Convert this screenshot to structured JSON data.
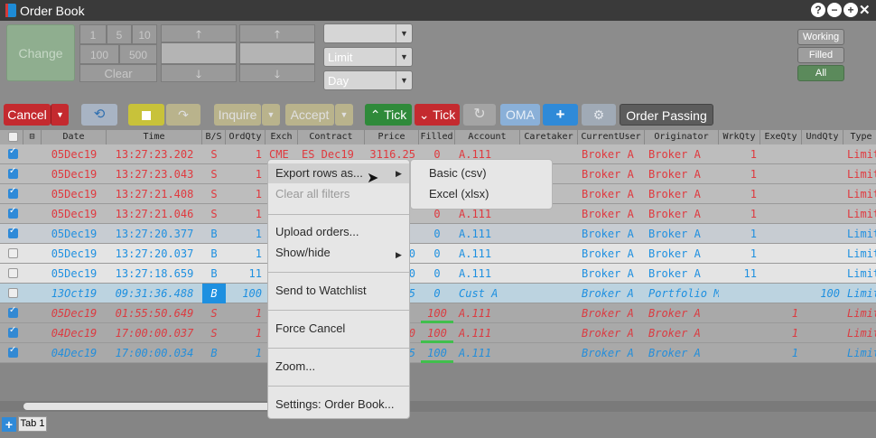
{
  "window": {
    "title": "Order Book",
    "controls": [
      "?",
      "−",
      "+",
      "✕"
    ]
  },
  "order_panel": {
    "change_label": "Change",
    "qty_keys": [
      "1",
      "5",
      "10",
      "100",
      "500"
    ],
    "clear_label": "Clear",
    "up_arrow": "🡑",
    "down_arrow": "🡓"
  },
  "selects": {
    "first_value": "",
    "order_type": "Limit",
    "duration": "Day"
  },
  "status_filters": {
    "working": "Working",
    "filled": "Filled",
    "all": "All"
  },
  "toolbar": {
    "cancel": "Cancel",
    "inquire": "Inquire",
    "accept": "Accept",
    "tick_up": "Tick",
    "tick_down": "Tick",
    "oma": "OMA",
    "add": "+",
    "order_passing": "Order Passing"
  },
  "columns": [
    "",
    "",
    "Date",
    "Time",
    "B/S",
    "OrdQty",
    "Exch",
    "Contract",
    "Price",
    "Filled",
    "Account",
    "Caretaker",
    "CurrentUser",
    "Originator",
    "WrkQty",
    "ExeQty",
    "UndQty",
    "Type"
  ],
  "rows": [
    {
      "checked": true,
      "date": "05Dec19",
      "time": "13:27:23.202",
      "bs": "S",
      "ordqty": "1",
      "exch": "CME",
      "contract": "ES Dec19",
      "price": "3116.25",
      "filled": "0",
      "account": "A.111",
      "caretaker": "",
      "currentuser": "Broker A",
      "originator": "Broker A",
      "wrkqty": "1",
      "exeqty": "",
      "undqty": "",
      "type": "Limit"
    },
    {
      "checked": true,
      "date": "05Dec19",
      "time": "13:27:23.043",
      "bs": "S",
      "ordqty": "1",
      "exch": "",
      "contract": "",
      "price": "",
      "filled": "",
      "account": "",
      "caretaker": "",
      "currentuser": "Broker A",
      "originator": "Broker A",
      "wrkqty": "1",
      "exeqty": "",
      "undqty": "",
      "type": "Limit"
    },
    {
      "checked": true,
      "date": "05Dec19",
      "time": "13:27:21.408",
      "bs": "S",
      "ordqty": "1",
      "exch": "",
      "contract": "",
      "price": "",
      "filled": "",
      "account": "",
      "caretaker": "",
      "currentuser": "Broker A",
      "originator": "Broker A",
      "wrkqty": "1",
      "exeqty": "",
      "undqty": "",
      "type": "Limit"
    },
    {
      "checked": true,
      "date": "05Dec19",
      "time": "13:27:21.046",
      "bs": "S",
      "ordqty": "1",
      "exch": "",
      "contract": "",
      "price": "",
      "filled": "0",
      "account": "A.111",
      "caretaker": "",
      "currentuser": "Broker A",
      "originator": "Broker A",
      "wrkqty": "1",
      "exeqty": "",
      "undqty": "",
      "type": "Limit"
    },
    {
      "checked": true,
      "date": "05Dec19",
      "time": "13:27:20.377",
      "bs": "B",
      "ordqty": "1",
      "exch": "",
      "contract": "",
      "price": "",
      "filled": "0",
      "account": "A.111",
      "caretaker": "",
      "currentuser": "Broker A",
      "originator": "Broker A",
      "wrkqty": "1",
      "exeqty": "",
      "undqty": "",
      "type": "Limit"
    },
    {
      "checked": false,
      "date": "05Dec19",
      "time": "13:27:20.037",
      "bs": "B",
      "ordqty": "1",
      "exch": "",
      "contract": "",
      "price": "0",
      "filled": "0",
      "account": "A.111",
      "caretaker": "",
      "currentuser": "Broker A",
      "originator": "Broker A",
      "wrkqty": "1",
      "exeqty": "",
      "undqty": "",
      "type": "Limit"
    },
    {
      "checked": false,
      "date": "05Dec19",
      "time": "13:27:18.659",
      "bs": "B",
      "ordqty": "11",
      "exch": "",
      "contract": "",
      "price": "0",
      "filled": "0",
      "account": "A.111",
      "caretaker": "",
      "currentuser": "Broker A",
      "originator": "Broker A",
      "wrkqty": "11",
      "exeqty": "",
      "undqty": "",
      "type": "Limit"
    },
    {
      "checked": false,
      "date": "13Oct19",
      "time": "09:31:36.488",
      "bs": "B",
      "ordqty": "100",
      "exch": "",
      "contract": "",
      "price": "5",
      "filled": "0",
      "account": "Cust A",
      "caretaker": "",
      "currentuser": "Broker A",
      "originator": "Portfolio M",
      "wrkqty": "",
      "exeqty": "",
      "undqty": "100",
      "type": "Limit"
    },
    {
      "checked": true,
      "date": "05Dec19",
      "time": "01:55:50.649",
      "bs": "S",
      "ordqty": "1",
      "exch": "",
      "contract": "",
      "price": "",
      "filled": "100",
      "account": "A.111",
      "caretaker": "",
      "currentuser": "Broker A",
      "originator": "Broker A",
      "wrkqty": "",
      "exeqty": "1",
      "undqty": "",
      "type": "Limit"
    },
    {
      "checked": true,
      "date": "04Dec19",
      "time": "17:00:00.037",
      "bs": "S",
      "ordqty": "1",
      "exch": "",
      "contract": "",
      "price": "0",
      "filled": "100",
      "account": "A.111",
      "caretaker": "",
      "currentuser": "Broker A",
      "originator": "Broker A",
      "wrkqty": "",
      "exeqty": "1",
      "undqty": "",
      "type": "Limit"
    },
    {
      "checked": true,
      "date": "04Dec19",
      "time": "17:00:00.034",
      "bs": "B",
      "ordqty": "1",
      "exch": "",
      "contract": "",
      "price": "5",
      "filled": "100",
      "account": "A.111",
      "caretaker": "",
      "currentuser": "Broker A",
      "originator": "Broker A",
      "wrkqty": "",
      "exeqty": "1",
      "undqty": "",
      "type": "Limit"
    }
  ],
  "context_menu": {
    "items": [
      "Export rows as...",
      "Clear all filters",
      "Upload orders...",
      "Show/hide",
      "Send to Watchlist",
      "Force Cancel",
      "Zoom...",
      "Settings: Order Book..."
    ]
  },
  "export_submenu": {
    "items": [
      "Basic (csv)",
      "Excel (xlsx)"
    ]
  },
  "tabs": {
    "add": "+",
    "tab1": "Tab 1"
  },
  "colors": {
    "sell": "#e0393e",
    "buy": "#1e90e0",
    "filled_bar": "#3ec34a",
    "accent": "#2f8ad8"
  }
}
